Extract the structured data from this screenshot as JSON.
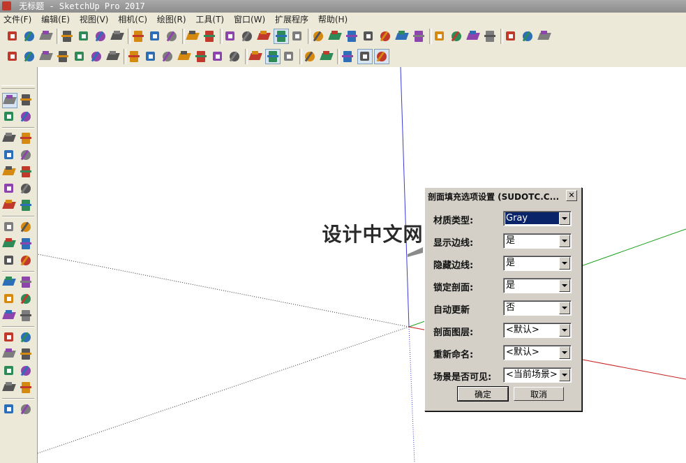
{
  "window": {
    "title": "无标题 - SketchUp Pro 2017"
  },
  "menubar": {
    "items": [
      "文件(F)",
      "编辑(E)",
      "视图(V)",
      "相机(C)",
      "绘图(R)",
      "工具(T)",
      "窗口(W)",
      "扩展程序",
      "帮助(H)"
    ]
  },
  "watermark": {
    "latin": "ARC",
    "chinese": "设计中文网"
  },
  "dialog": {
    "title": "剖面填充选项设置 (SUDOTC.C...",
    "close_glyph": "✕",
    "fields": [
      {
        "label": "材质类型:",
        "value": "Gray"
      },
      {
        "label": "显示边线:",
        "value": "是"
      },
      {
        "label": "隐藏边线:",
        "value": "是"
      },
      {
        "label": "锁定剖面:",
        "value": "是"
      },
      {
        "label": "自动更新",
        "value": "否"
      },
      {
        "label": "剖面图层:",
        "value": "<默认>"
      },
      {
        "label": "重新命名:",
        "value": "<默认>"
      },
      {
        "label": "场景是否可见:",
        "value": "<当前场景>"
      }
    ],
    "ok_label": "确定",
    "cancel_label": "取消"
  },
  "axes": {
    "blue": "#3a3ad6",
    "green": "#18a018",
    "red": "#c81e1e"
  },
  "toolbar_icons": {
    "row1": [
      "new-icon",
      "open-icon",
      "save-icon",
      "cut-icon",
      "copy-icon",
      "paste-icon",
      "erase-icon",
      "undo-icon",
      "redo-icon",
      "print-icon",
      "model-info-icon",
      "xray-icon",
      "back-edges-icon",
      "wireframe-icon",
      "hidden-line-icon",
      "shaded-icon",
      "shaded-textures-icon",
      "monochrome-icon",
      "iso-view-icon",
      "top-view-icon",
      "front-view-icon",
      "right-view-icon",
      "back-view-icon",
      "left-view-icon",
      "sandbox-icon",
      "section-plane-icon",
      "display-section-icon",
      "warehouse-icon",
      "extension-warehouse-icon",
      "scale-icon",
      "plugin-icon"
    ],
    "row2": [
      "plugin-tool-icon",
      "section-fill-icon",
      "dimension-icon",
      "line-tool-icon",
      "curve-tool-icon",
      "shape-tool-icon",
      "arc-tool-icon",
      "offset-tool-icon",
      "box-icon",
      "component-icon",
      "color-icon",
      "layer-icon",
      "camera-icon",
      "texture-icon",
      "dynamic-icon",
      "pressed-icon",
      "sun-icon",
      "shadow-icon",
      "fog-icon",
      "edge-style-icon",
      "view-icon",
      "cube-icon"
    ]
  },
  "palette_icons": [
    "select-icon",
    "make-component-icon",
    "paint-bucket-icon",
    "eraser-icon",
    "pencil-icon",
    "freehand-icon",
    "rectangle-icon",
    "rotated-rectangle-icon",
    "circle-icon",
    "polygon-icon",
    "arc-icon",
    "pie-icon",
    "two-point-arc-icon",
    "three-point-arc-icon",
    "move-icon",
    "push-pull-icon",
    "rotate-icon",
    "follow-me-icon",
    "scale-icon",
    "offset-icon",
    "tape-measure-icon",
    "text-icon",
    "protractor-icon",
    "3d-text-icon",
    "axes-icon",
    "dimension-icon",
    "orbit-icon",
    "pan-icon",
    "zoom-icon",
    "zoom-window-icon",
    "zoom-extents-icon",
    "previous-icon",
    "position-camera-icon",
    "look-around-icon",
    "walk-icon",
    "section-plane-icon"
  ]
}
